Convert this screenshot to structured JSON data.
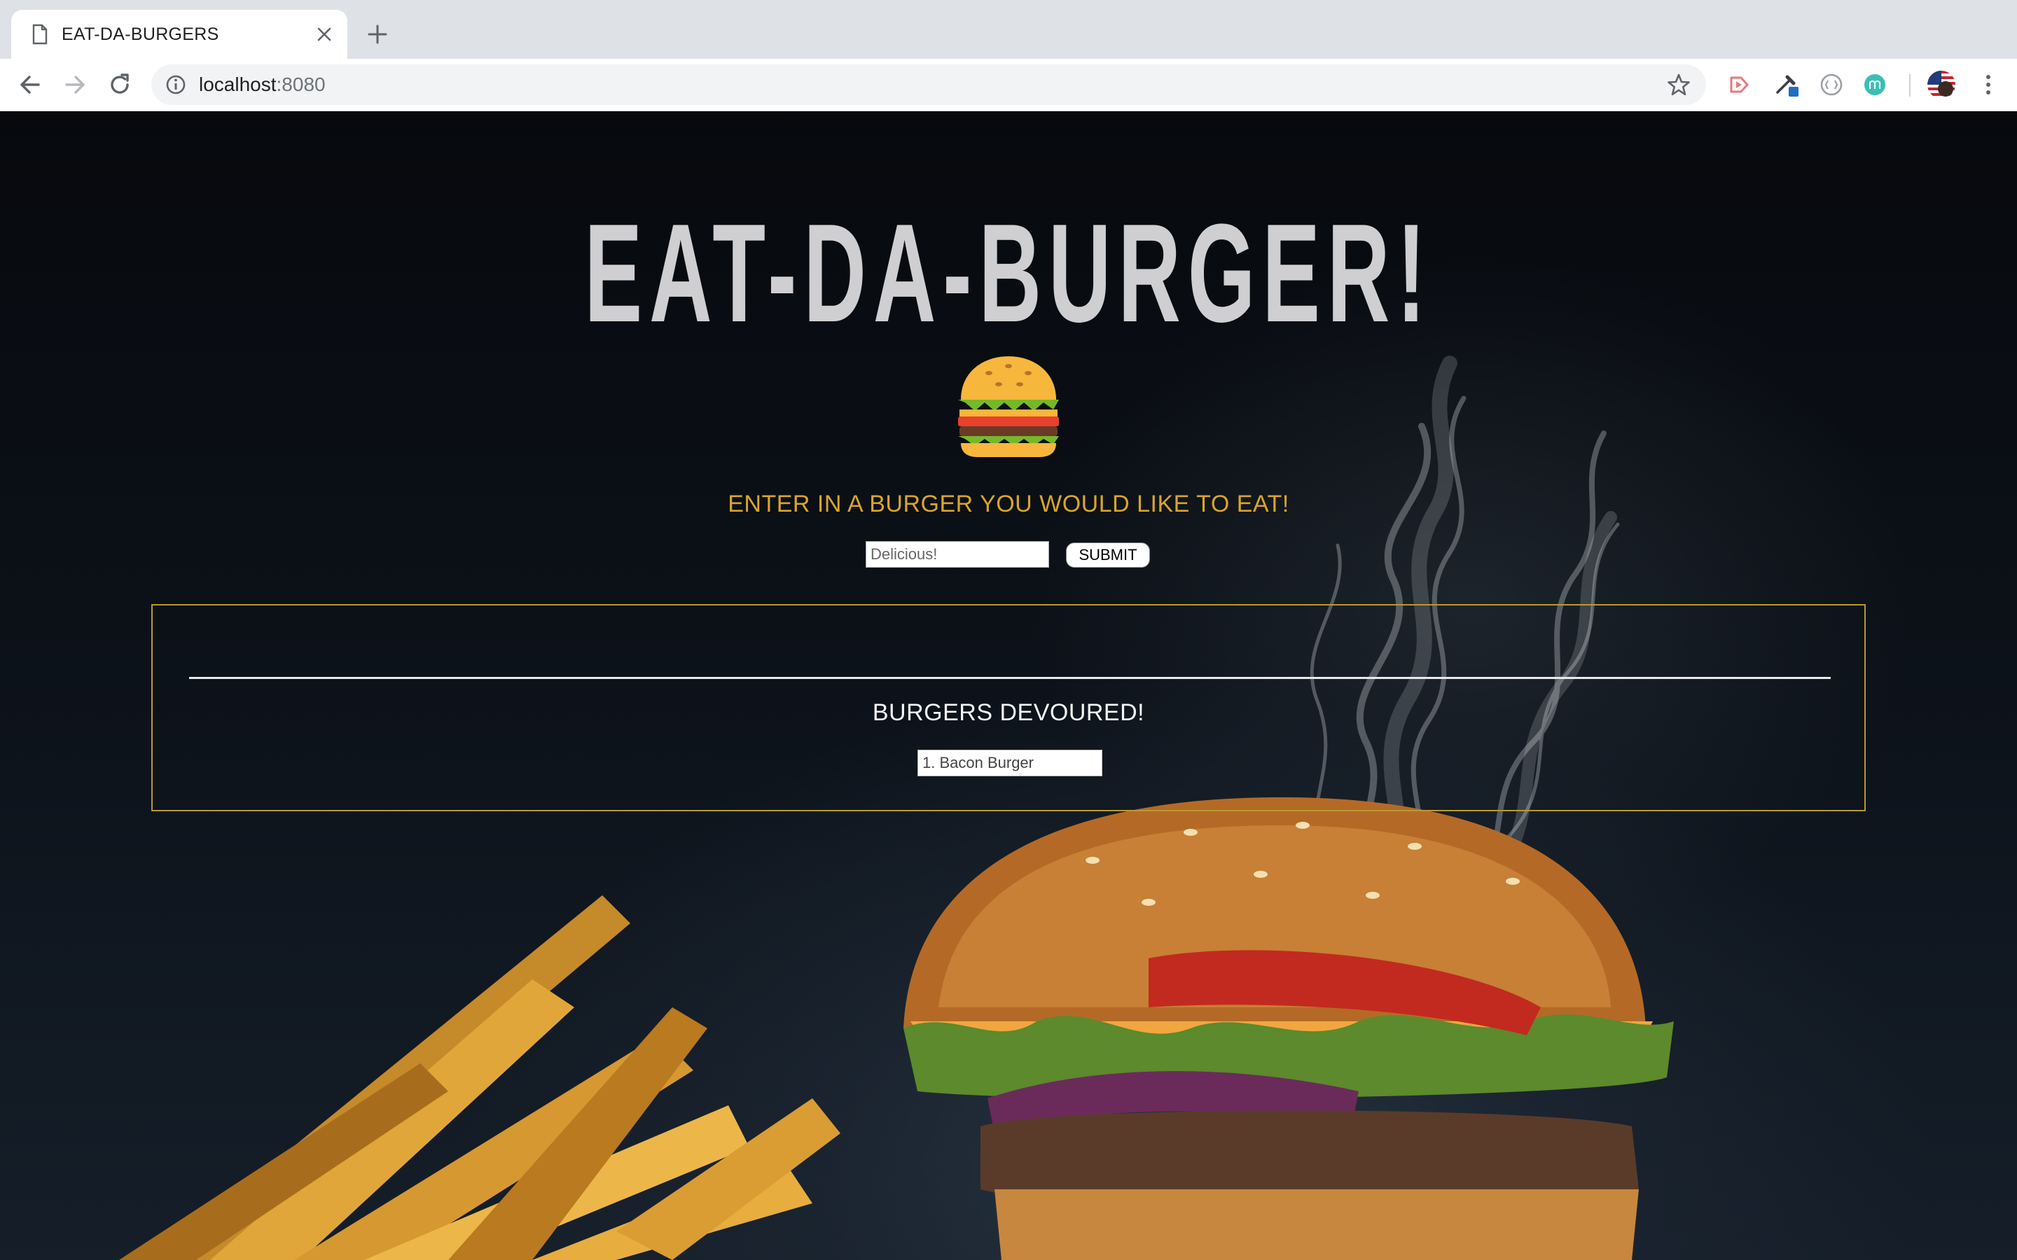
{
  "browser": {
    "tab_title": "EAT-DA-BURGERS",
    "url_host": "localhost",
    "url_port": ":8080"
  },
  "page": {
    "headline": "EAT-DA-BURGER!",
    "prompt": "ENTER IN A BURGER YOU WOULD LIKE TO EAT!",
    "input_placeholder": "Delicious!",
    "submit_label": "SUBMIT",
    "devoured_title": "BURGERS DEVOURED!",
    "devoured_items": [
      "1. Bacon Burger"
    ]
  },
  "colors": {
    "accent_gold": "#d9a527",
    "box_border": "#b99a2c",
    "headline": "#cfcfd1",
    "background": "#0b0f15"
  },
  "icons": [
    "document-icon",
    "close-icon",
    "plus-icon",
    "back-arrow-icon",
    "forward-arrow-icon",
    "reload-icon",
    "info-icon",
    "star-icon",
    "burger-emoji-icon"
  ]
}
